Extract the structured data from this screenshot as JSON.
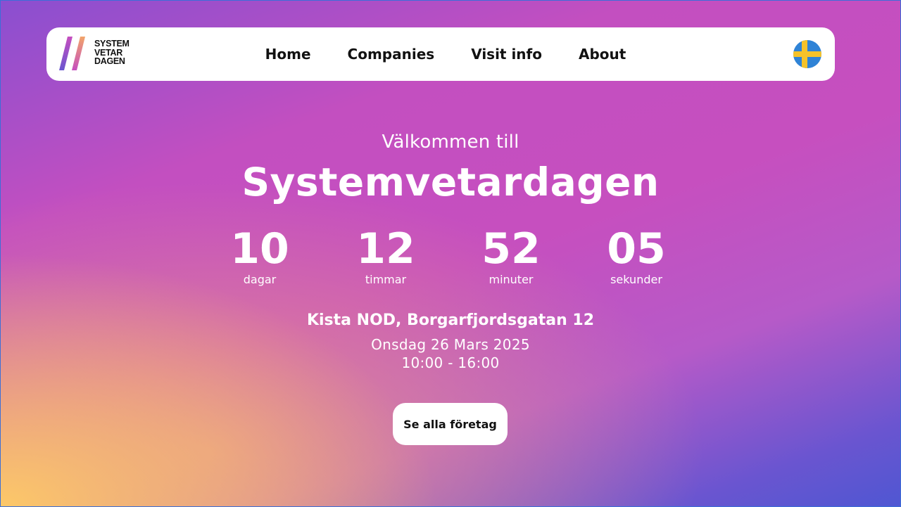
{
  "brand": {
    "logo_lines": [
      "SYSTEM",
      "VETAR",
      "DAGEN"
    ]
  },
  "nav": {
    "items": [
      "Home",
      "Companies",
      "Visit info",
      "About"
    ],
    "language_icon": "swedish-flag-icon"
  },
  "hero": {
    "welcome": "Välkommen till",
    "title": "Systemvetardagen",
    "countdown": [
      {
        "value": "10",
        "label": "dagar"
      },
      {
        "value": "12",
        "label": "timmar"
      },
      {
        "value": "52",
        "label": "minuter"
      },
      {
        "value": "05",
        "label": "sekunder"
      }
    ],
    "venue": "Kista NOD, Borgarfjordsgatan 12",
    "date": "Onsdag 26 Mars 2025",
    "time": "10:00 - 16:00",
    "cta_label": "Se alla företag"
  },
  "colors": {
    "gradient_top": "#8a4fd0",
    "gradient_mid": "#c64fbf",
    "gradient_right": "#4f57d2",
    "gradient_bottom_left": "#ffcd64",
    "flag_blue": "#2f83d6",
    "flag_yellow": "#f5c229"
  }
}
